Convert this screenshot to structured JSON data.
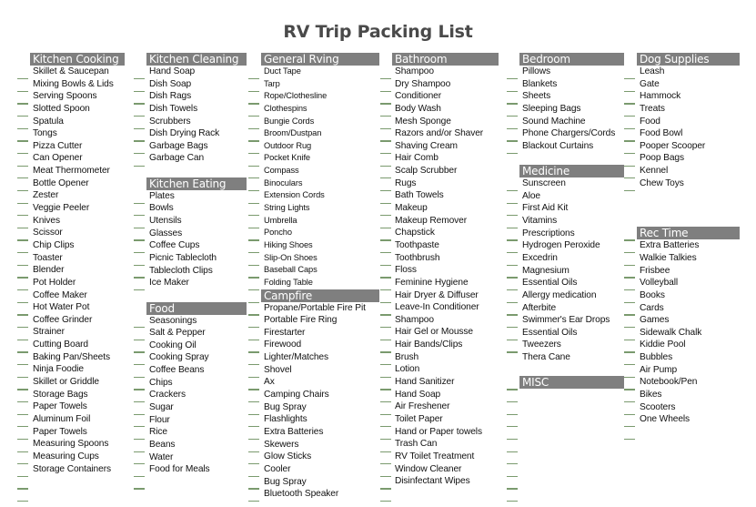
{
  "title": "RV Trip Packing List",
  "columns": [
    {
      "sections": [
        {
          "header": "Kitchen Cooking",
          "items": [
            "Skillet & Saucepan",
            "Mixing Bowls & Lids",
            "Serving Spoons",
            "Slotted Spoon",
            "Spatula",
            "Tongs",
            "Pizza Cutter",
            "Can Opener",
            "Meat Thermometer",
            "Bottle Opener",
            "Zester",
            "Veggie Peeler",
            "Knives",
            "Scissor",
            "Chip Clips",
            "Toaster",
            "Blender",
            "Pot Holder",
            "Coffee Maker",
            "Hot Water Pot",
            "Coffee Grinder",
            "Strainer",
            "Cutting Board",
            "Baking Pan/Sheets",
            "Ninja Foodie",
            "Skillet or Griddle",
            "Storage Bags",
            "Paper Towels",
            "Aluminum Foil",
            "Paper Towels",
            "Measuring Spoons",
            "Measuring Cups",
            "Storage Containers"
          ]
        }
      ]
    },
    {
      "sections": [
        {
          "header": "Kitchen Cleaning",
          "items": [
            "Hand Soap",
            "Dish Soap",
            "Dish Rags",
            "Dish Towels",
            "Scrubbers",
            "Dish Drying Rack",
            "Garbage Bags",
            "Garbage Can"
          ]
        },
        {
          "header": "Kitchen Eating",
          "items": [
            "Plates",
            "Bowls",
            "Utensils",
            "Glasses",
            "Coffee Cups",
            "Picnic Tablecloth",
            "Tablecloth Clips",
            "Ice Maker"
          ]
        },
        {
          "header": "Food",
          "items": [
            "Seasonings",
            "Salt & Pepper",
            "Cooking Oil",
            "Cooking Spray",
            "Coffee Beans",
            "Chips",
            "Crackers",
            "Sugar",
            "Flour",
            "Rice",
            "Beans",
            "Water",
            "Food for Meals"
          ]
        }
      ]
    },
    {
      "sections": [
        {
          "header": "General Rving",
          "items": [
            "Duct Tape",
            "Tarp",
            "Rope/Clothesline",
            "Clothespins",
            "Bungie Cords",
            "Broom/Dustpan",
            "Outdoor Rug",
            "Pocket Knife",
            "Compass",
            "Binoculars",
            "Extension Cords",
            "String Lights",
            "Umbrella",
            "Poncho",
            "Hiking Shoes",
            "Slip-On Shoes",
            "Baseball Caps",
            "Folding Table"
          ]
        },
        {
          "header": "Campfire",
          "items": [
            "Propane/Portable Fire Pit",
            "Portable Fire Ring",
            "Firestarter",
            "Firewood",
            "Lighter/Matches",
            "Shovel",
            "Ax",
            "Camping Chairs",
            "Bug Spray",
            "Flashlights",
            "Extra Batteries",
            "Skewers",
            "Glow Sticks",
            "Cooler",
            "Bug Spray",
            "Bluetooth Speaker"
          ]
        }
      ]
    },
    {
      "sections": [
        {
          "header": "Bathroom",
          "items": [
            "Shampoo",
            "Dry Shampoo",
            "Conditioner",
            "Body Wash",
            "Mesh Sponge",
            "Razors and/or Shaver",
            "Shaving Cream",
            "Hair Comb",
            "Scalp Scrubber",
            "Rugs",
            "Bath Towels",
            "Makeup",
            "Makeup Remover",
            "Chapstick",
            "Toothpaste",
            "Toothbrush",
            "Floss",
            "Feminine Hygiene",
            "Hair Dryer & Diffuser",
            "Leave-In Conditioner",
            "Shampoo",
            "Hair Gel or Mousse",
            "Hair Bands/Clips",
            "Brush",
            "Lotion",
            "Hand Sanitizer",
            "Hand Soap",
            "Air Freshener",
            "Toilet Paper",
            "Hand  or Paper towels",
            "Trash Can",
            "RV Toilet Treatment",
            "Window Cleaner",
            "Disinfectant Wipes"
          ]
        }
      ]
    },
    {
      "sections": [
        {
          "header": "Bedroom",
          "items": [
            "Pillows",
            "Blankets",
            "Sheets",
            "Sleeping Bags",
            "Sound Machine",
            "Phone Chargers/Cords",
            "Blackout Curtains"
          ]
        },
        {
          "header": "Medicine",
          "items": [
            "Sunscreen",
            "Aloe",
            "First Aid Kit",
            "Vitamins",
            "Prescriptions",
            "Hydrogen Peroxide",
            "Excedrin",
            "Magnesium",
            "Essential Oils",
            "Allergy medication",
            "Afterbite",
            "Swimmer's Ear Drops",
            "Essential Oils",
            "Tweezers",
            "Thera Cane"
          ]
        },
        {
          "header": "MISC",
          "items": []
        }
      ]
    },
    {
      "sections": [
        {
          "header": "Dog Supplies",
          "items": [
            "Leash",
            "Gate",
            "Hammock",
            "Treats",
            "Food",
            "Food Bowl",
            "Pooper Scooper",
            "Poop Bags",
            "Kennel",
            "Chew Toys"
          ]
        },
        {
          "header": "Rec Time",
          "items": [
            "Extra Batteries",
            "Walkie Talkies",
            "Frisbee",
            "Volleyball",
            "Books",
            "Cards",
            "Games",
            "Sidewalk Chalk",
            "Kiddie Pool",
            "Bubbles",
            "Air Pump",
            "Notebook/Pen",
            "Bikes",
            "Scooters",
            "One Wheels"
          ]
        }
      ]
    }
  ]
}
